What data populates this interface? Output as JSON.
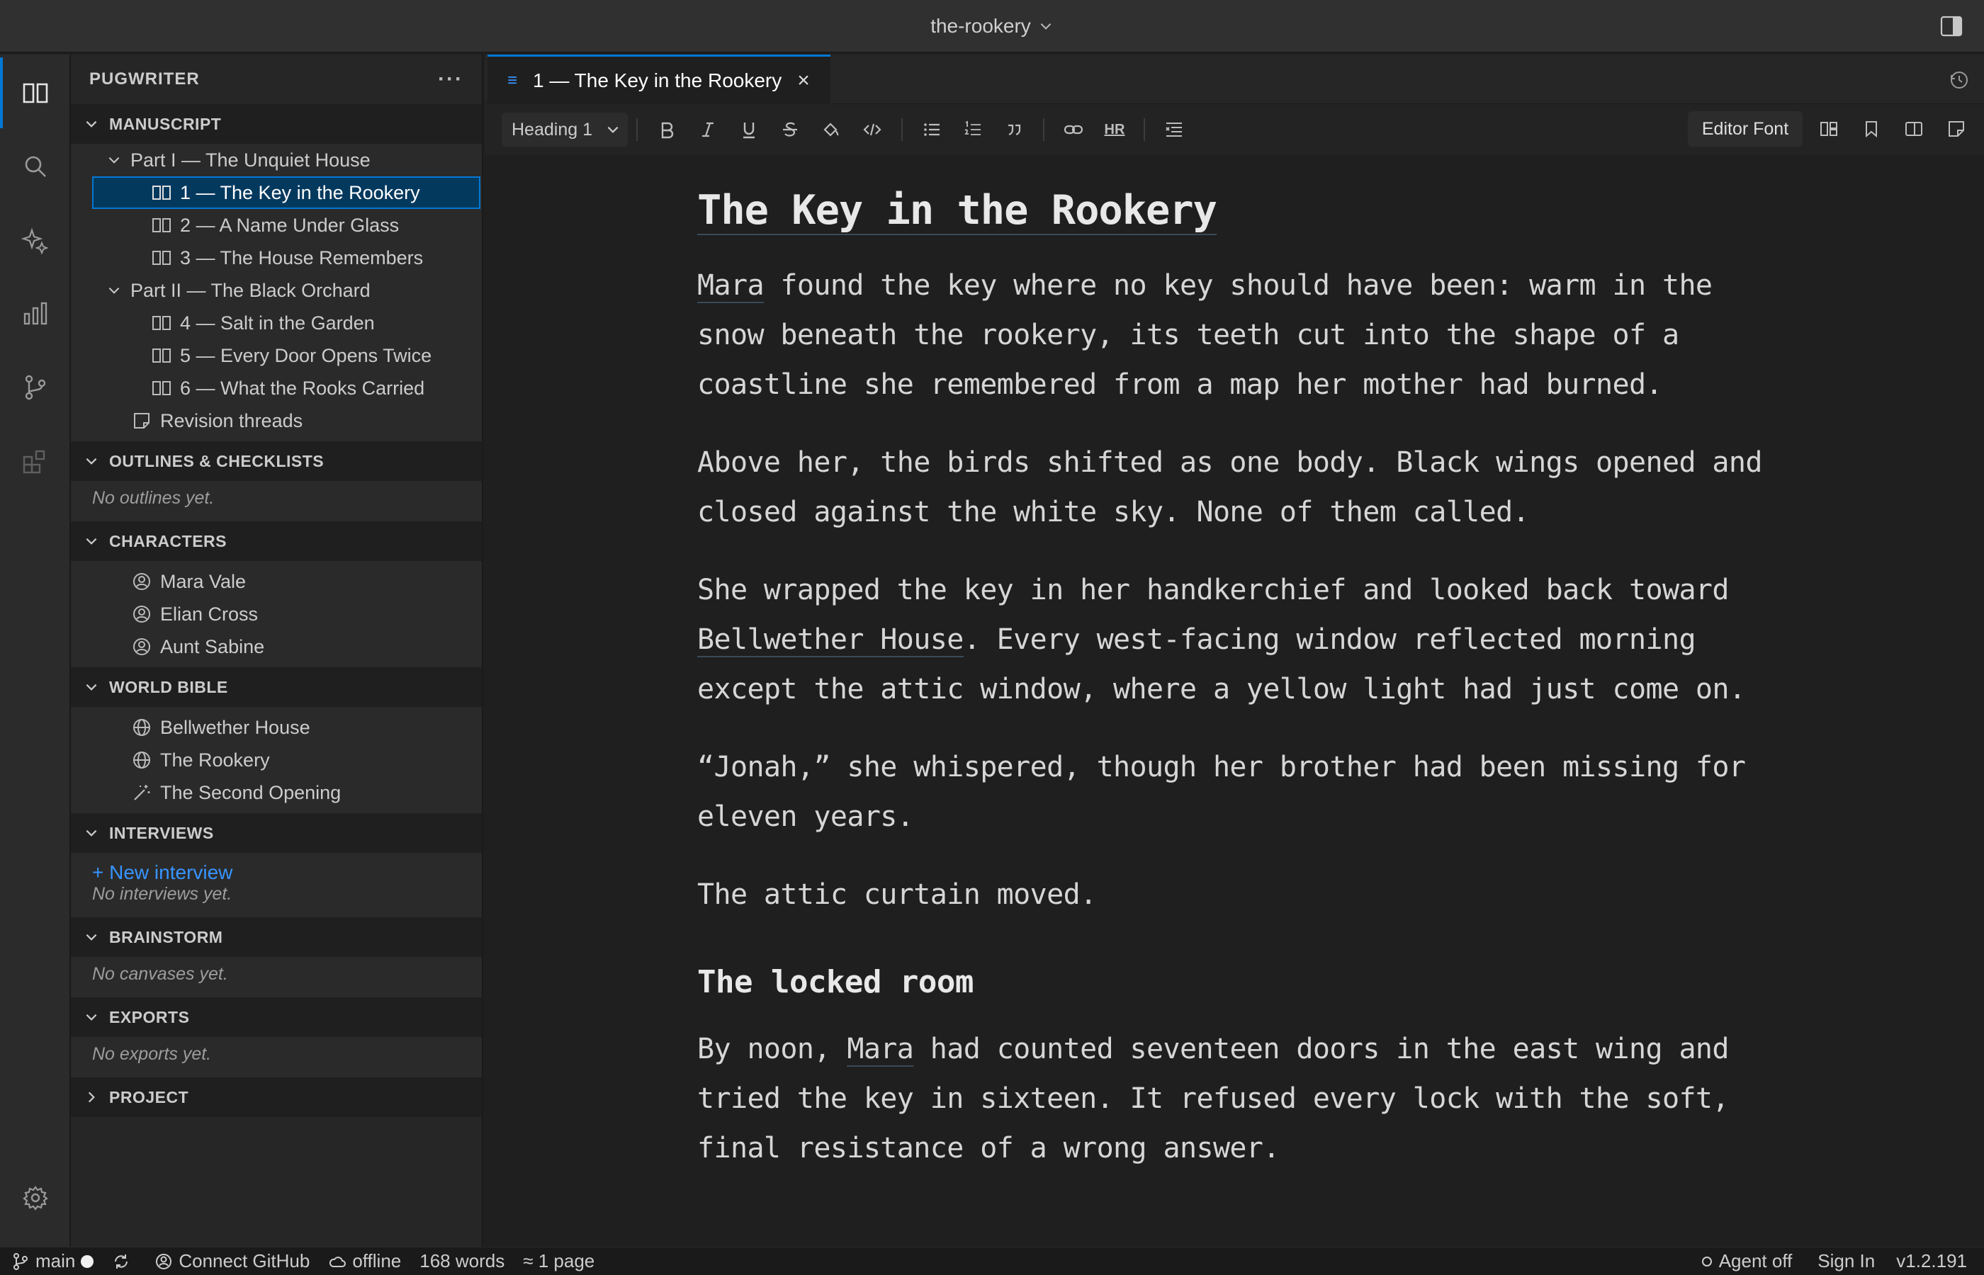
{
  "window": {
    "title": "the-rookery"
  },
  "sidebar": {
    "header": "PUGWRITER",
    "more": "···",
    "manuscript": {
      "label": "MANUSCRIPT",
      "parts": [
        {
          "label": "Part I — The Unquiet House",
          "chapters": [
            "1 — The Key in the Rookery",
            "2 — A Name Under Glass",
            "3 — The House Remembers"
          ]
        },
        {
          "label": "Part II — The Black Orchard",
          "chapters": [
            "4 — Salt in the Garden",
            "5 — Every Door Opens Twice",
            "6 — What the Rooks Carried"
          ]
        }
      ],
      "extra": "Revision threads"
    },
    "outlines": {
      "label": "OUTLINES & CHECKLISTS",
      "empty": "No outlines yet."
    },
    "characters": {
      "label": "CHARACTERS",
      "items": [
        "Mara Vale",
        "Elian Cross",
        "Aunt Sabine"
      ]
    },
    "world": {
      "label": "WORLD BIBLE",
      "items": [
        "Bellwether House",
        "The Rookery",
        "The Second Opening"
      ]
    },
    "interviews": {
      "label": "INTERVIEWS",
      "new": "+ New interview",
      "empty": "No interviews yet."
    },
    "brainstorm": {
      "label": "BRAINSTORM",
      "empty": "No canvases yet."
    },
    "exports": {
      "label": "EXPORTS",
      "empty": "No exports yet."
    },
    "project": {
      "label": "PROJECT"
    }
  },
  "tab": {
    "label": "1 — The Key in the Rookery",
    "close": "×",
    "icon": "≡"
  },
  "toolbar": {
    "style": "Heading 1",
    "underline": "U",
    "hr": "HR",
    "font": "Editor Font"
  },
  "document": {
    "title": "The Key in the Rookery",
    "p1": {
      "name": "Mara",
      "rest": " found the key where no key should have been: warm in the snow beneath the rookery, its teeth cut into the shape of a coastline she remembered from a map her mother had burned."
    },
    "p2": "Above her, the birds shifted as one body. Black wings opened and closed against the white sky. None of them called.",
    "p3": {
      "before": "She wrapped the key in her handkerchief and looked back toward ",
      "place": "Bellwether House",
      "after": ". Every west-facing window reflected morning except the attic window, where a yellow light had just come on."
    },
    "p4": "“Jonah,” she whispered, though her brother had been missing for eleven years.",
    "p5": "The attic curtain moved.",
    "h2": "The locked room",
    "p6": {
      "before": "By noon, ",
      "name": "Mara",
      "after": " had counted seventeen doors in the east wing and tried the key in sixteen. It refused every lock with the soft, final resistance of a wrong answer."
    }
  },
  "status": {
    "branch": "main",
    "github": "Connect GitHub",
    "network": "offline",
    "words": "168 words",
    "pages": "≈ 1 page",
    "agent": "Agent off",
    "signin": "Sign In",
    "version": "v1.2.191"
  },
  "colors": {
    "accent": "#0078d4",
    "link": "#3794ff",
    "selection": "#04395e"
  }
}
